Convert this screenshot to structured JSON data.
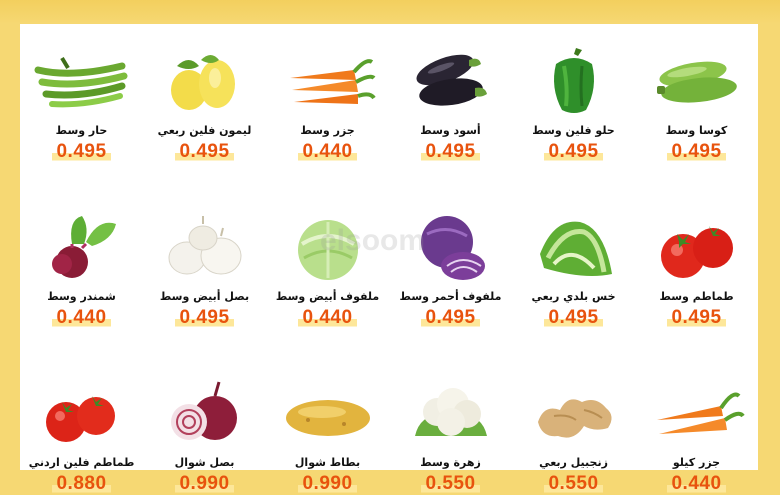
{
  "watermark": "elsoom",
  "products": [
    {
      "name": "كوسا وسط",
      "price": "0.495",
      "icon": "zucchini-icon"
    },
    {
      "name": "حلو فلين وسط",
      "price": "0.495",
      "icon": "green-pepper-icon"
    },
    {
      "name": "أسود وسط",
      "price": "0.495",
      "icon": "eggplant-icon"
    },
    {
      "name": "جزر وسط",
      "price": "0.440",
      "icon": "carrot-icon"
    },
    {
      "name": "ليمون فلين ربعي",
      "price": "0.495",
      "icon": "lemon-icon"
    },
    {
      "name": "حار وسط",
      "price": "0.495",
      "icon": "chili-pepper-icon"
    },
    {
      "name": "طماطم وسط",
      "price": "0.495",
      "icon": "tomato-icon"
    },
    {
      "name": "خس بلدي ربعي",
      "price": "0.495",
      "icon": "lettuce-icon"
    },
    {
      "name": "ملفوف أحمر وسط",
      "price": "0.495",
      "icon": "red-cabbage-icon"
    },
    {
      "name": "ملفوف أبيض وسط",
      "price": "0.440",
      "icon": "white-cabbage-icon"
    },
    {
      "name": "بصل أبيض وسط",
      "price": "0.495",
      "icon": "white-onion-icon"
    },
    {
      "name": "شمندر وسط",
      "price": "0.440",
      "icon": "beetroot-icon"
    },
    {
      "name": "جزر كيلو",
      "price": "0.440",
      "icon": "carrot-kilo-icon"
    },
    {
      "name": "زنجبيل ربعي",
      "price": "0.550",
      "icon": "ginger-icon"
    },
    {
      "name": "زهرة وسط",
      "price": "0.550",
      "icon": "cauliflower-icon"
    },
    {
      "name": "بطاط شوال",
      "price": "0.990",
      "icon": "potato-icon"
    },
    {
      "name": "بصل شوال",
      "price": "0.990",
      "icon": "red-onion-icon"
    },
    {
      "name": "طماطم فلين اردني",
      "price": "0.880",
      "icon": "tomato-jordan-icon"
    }
  ]
}
